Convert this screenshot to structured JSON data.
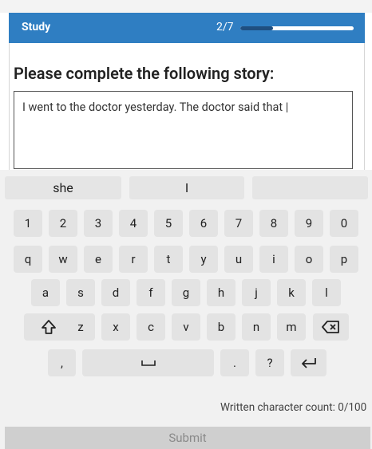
{
  "header": {
    "title": "Study",
    "step": "2/7",
    "progress_fraction": 0.286,
    "accent": "#2f7ec2"
  },
  "prompt": "Please complete the following story:",
  "story_text": "I went to the doctor yesterday. The doctor said that |",
  "suggestions": [
    "she",
    "I",
    ""
  ],
  "rows": {
    "numbers": [
      "1",
      "2",
      "3",
      "4",
      "5",
      "6",
      "7",
      "8",
      "9",
      "0"
    ],
    "row1": [
      "q",
      "w",
      "e",
      "r",
      "t",
      "y",
      "u",
      "i",
      "o",
      "p"
    ],
    "row2": [
      "a",
      "s",
      "d",
      "f",
      "g",
      "h",
      "j",
      "k",
      "l"
    ],
    "row3": [
      "z",
      "x",
      "c",
      "v",
      "b",
      "n",
      "m"
    ],
    "comma": ",",
    "period": ".",
    "question": "?"
  },
  "icons": {
    "shift": "shift-icon",
    "backspace": "backspace-icon",
    "space": "space-icon",
    "enter": "enter-icon"
  },
  "char_count": "Written character count: 0/100",
  "submit_label": "Submit"
}
